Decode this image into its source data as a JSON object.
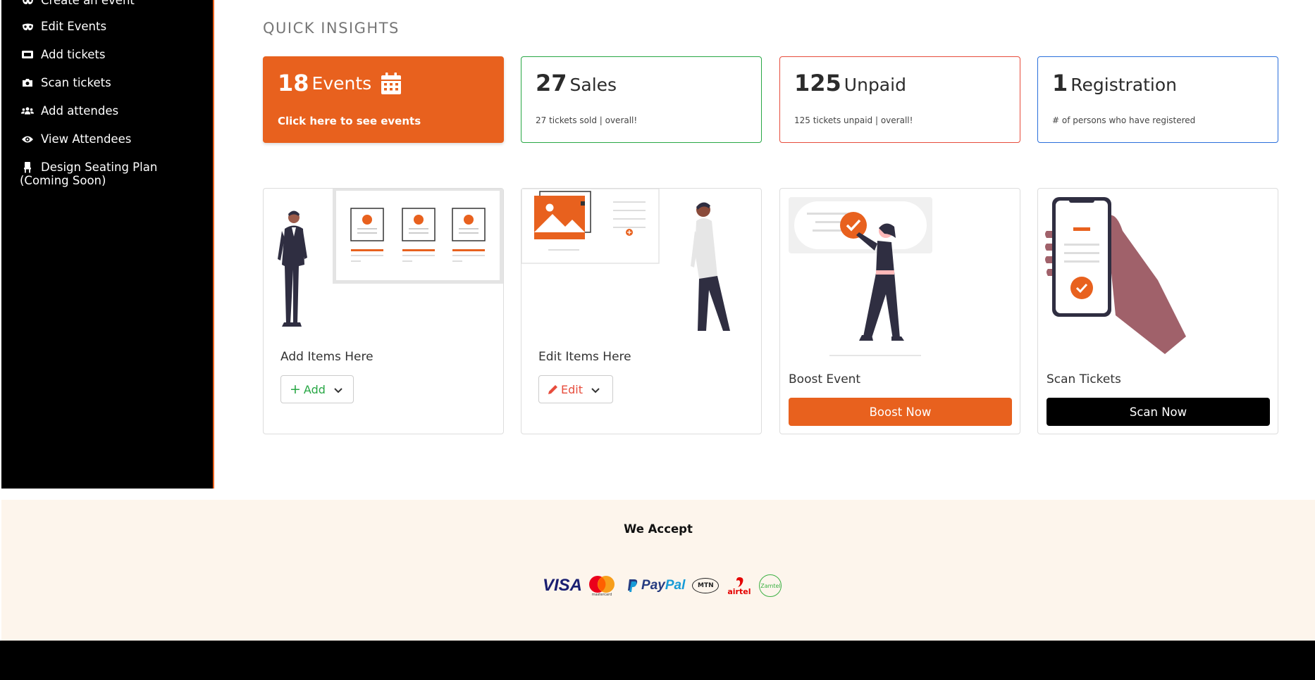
{
  "sidebar": {
    "items": [
      {
        "label": "Create an event",
        "icon": "mask-icon"
      },
      {
        "label": "Edit Events",
        "icon": "mask-icon"
      },
      {
        "label": "Add tickets",
        "icon": "ticket-icon"
      },
      {
        "label": "Scan tickets",
        "icon": "camera-icon"
      },
      {
        "label": "Add attendes",
        "icon": "users-icon"
      },
      {
        "label": "View Attendees",
        "icon": "eye-icon"
      },
      {
        "label_line1": "Design Seating Plan",
        "label_line2": "(Coming Soon)",
        "icon": "chair-icon"
      }
    ]
  },
  "main": {
    "section_title": "QUICK INSIGHTS",
    "stats": [
      {
        "number": "18",
        "label": "Events",
        "sub": "Click here to see events",
        "icon": "calendar-icon"
      },
      {
        "number": "27",
        "label": "Sales",
        "sub": "27 tickets sold | overall!"
      },
      {
        "number": "125",
        "label": "Unpaid",
        "sub": "125 tickets unpaid | overall!"
      },
      {
        "number": "1",
        "label": "Registration",
        "sub": "# of persons who have registered"
      }
    ],
    "cards": [
      {
        "title": "Add Items Here",
        "button": "Add",
        "button_icon": "plus-icon"
      },
      {
        "title": "Edit Items Here",
        "button": "Edit",
        "button_icon": "pencil-icon"
      },
      {
        "title": "Boost Event",
        "button": "Boost Now"
      },
      {
        "title": "Scan Tickets",
        "button": "Scan Now"
      }
    ]
  },
  "footer": {
    "we_accept": "We Accept",
    "logos": {
      "visa": "VISA",
      "mastercard": "mastercard",
      "paypal_a": "Pay",
      "paypal_b": "Pal",
      "mtn": "MTN",
      "airtel": "airtel",
      "zamtel": "Zamtel"
    }
  },
  "colors": {
    "accent": "#e8611e",
    "sales_border": "#28a745",
    "unpaid_border": "#e74c3c",
    "registration_border": "#2a6fdb",
    "footer_bg": "#fdf5ec"
  }
}
